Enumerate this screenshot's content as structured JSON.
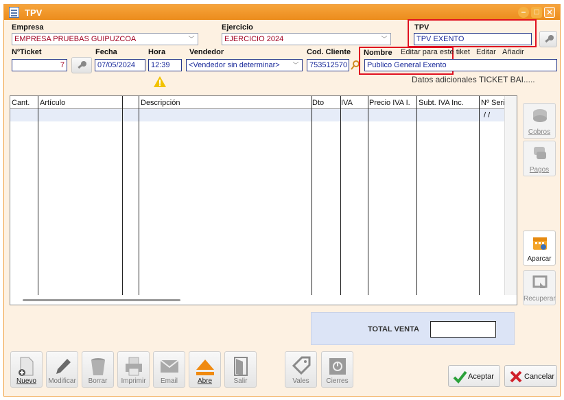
{
  "window": {
    "title": "TPV"
  },
  "header": {
    "empresa_label": "Empresa",
    "empresa_value": "EMPRESA PRUEBAS GUIPUZCOA",
    "ejercicio_label": "Ejercicio",
    "ejercicio_value": "EJERCICIO 2024",
    "tpv_label": "TPV",
    "tpv_value": "TPV EXENTO",
    "ticket_label": "NºTicket",
    "ticket_value": "7",
    "fecha_label": "Fecha",
    "fecha_value": "07/05/2024",
    "hora_label": "Hora",
    "hora_value": "12:39",
    "vendedor_label": "Vendedor",
    "vendedor_value": "<Vendedor sin determinar>",
    "codcliente_label": "Cod. Cliente",
    "codcliente_value": "753512570",
    "nombre_label": "Nombre",
    "nombre_value": "Publico General Exento",
    "link_editar_ticket": "Editar para este tiket",
    "link_editar": "Editar",
    "link_anadir": "Añadir",
    "datos_adicionales": "Datos adicionales TICKET BAI....."
  },
  "grid": {
    "columns": [
      "Cant.",
      "Artículo",
      "",
      "Descripción",
      "Dto",
      "IVA",
      "Precio IVA I.",
      "Subt. IVA Inc.",
      "Nº Serie"
    ],
    "row0_serie": "/ /"
  },
  "side": {
    "cobros": "Cobros",
    "pagos": "Pagos",
    "aparcar": "Aparcar",
    "recuperar": "Recuperar"
  },
  "totals": {
    "label": "TOTAL VENTA",
    "value": ""
  },
  "toolbar": {
    "nuevo": "Nuevo",
    "modificar": "Modificar",
    "borrar": "Borrar",
    "imprimir": "Imprimir",
    "email": "Email",
    "abre": "Abre",
    "salir": "Salir",
    "vales": "Vales",
    "cierres": "Cierres",
    "aceptar": "Aceptar",
    "cancelar": "Cancelar"
  },
  "colors": {
    "titlebar": "#ec8c1c",
    "highlight_box": "#e01020",
    "background": "#fdf1e2"
  }
}
